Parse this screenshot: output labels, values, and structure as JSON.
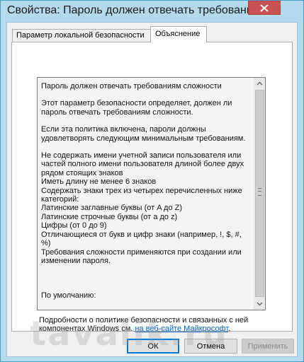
{
  "window": {
    "title": "Свойства: Пароль должен отвечать требования..."
  },
  "tabs": [
    {
      "label": "Параметр локальной безопасности",
      "active": false
    },
    {
      "label": "Объяснение",
      "active": true
    }
  ],
  "explanation": {
    "paragraphs": [
      "Пароль должен отвечать требованиям сложности",
      "Этот параметр безопасности определяет, должен ли\nпароль отвечать требованиям сложности.",
      "Если эта политика включена, пароли должны\nудовлетворять следующим минимальным требованиям.",
      "Не содержать имени учетной записи пользователя или\nчастей полного имени пользователя длиной более двух\nрядом стоящих знаков\nИметь длину не менее 6 знаков\nСодержать знаки трех из четырех перечисленных ниже\nкатегорий:\nЛатинские заглавные буквы (от A до Z)\nЛатинские строчные буквы (от a до z)\nЦифры (от 0 до 9)\nОтличающиеся от букв и цифр знаки (например, !, $, #, %)\nТребования сложности применяются при создании или\nизменении пароля.",
      "\n\nПо умолчанию:"
    ]
  },
  "details": {
    "text": "Подробности о политике безопасности и связанных с ней\nкомпонентах Windows см. ",
    "link": "на веб-сайте Майкрософт",
    "suffix": "."
  },
  "buttons": {
    "ok": "ОК",
    "cancel": "Отмена",
    "apply": "Применить"
  },
  "watermark": "tavalik.ru",
  "colors": {
    "titlebar": "#b2daec",
    "close": "#c75050",
    "link": "#0066cc"
  },
  "icons": {
    "close": "close-icon",
    "scroll_up": "chevron-up-icon",
    "scroll_down": "chevron-down-icon"
  }
}
